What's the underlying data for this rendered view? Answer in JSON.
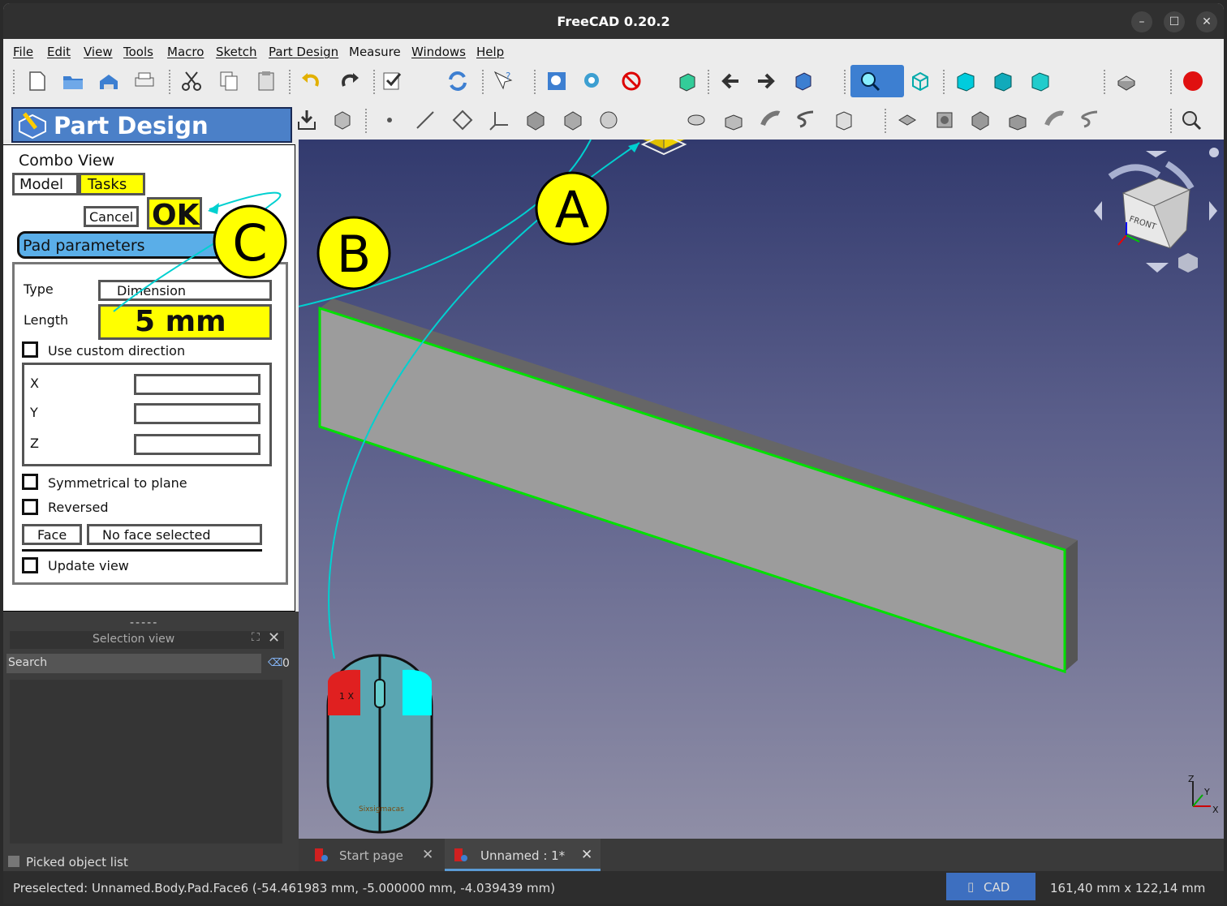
{
  "window": {
    "title": "FreeCAD 0.20.2"
  },
  "menu": [
    "File",
    "Edit",
    "View",
    "Tools",
    "Macro",
    "Sketch",
    "Part Design",
    "Measure",
    "Windows",
    "Help"
  ],
  "workbench": {
    "label": "Part Design"
  },
  "combo": {
    "title": "Combo View",
    "tabs": {
      "model": "Model",
      "tasks": "Tasks"
    },
    "cancel_label": "Cancel",
    "ok_label": "OK",
    "section_title": "Pad parameters",
    "type_label": "Type",
    "type_value": "Dimension",
    "length_label": "Length",
    "length_value": "5 mm",
    "custom_direction_label": "Use custom direction",
    "axis_labels": {
      "x": "X",
      "y": "Y",
      "z": "Z"
    },
    "symmetrical_label": "Symmetrical to plane",
    "reversed_label": "Reversed",
    "face_button": "Face",
    "face_value": "No face selected",
    "update_view_label": "Update view",
    "splitter": "-----"
  },
  "selection_view": {
    "title": "Selection view",
    "search_label": "Search",
    "count": "0",
    "picked_label": "Picked object list"
  },
  "annotations": {
    "a": "A",
    "b": "B",
    "c": "C",
    "mouse_click": "1 X",
    "mouse_brand": "Sixsigmacas"
  },
  "navcube": {
    "face_label": "FRONT"
  },
  "axes": {
    "x": "X",
    "y": "Y",
    "z": "Z"
  },
  "tabs": {
    "start": "Start page",
    "doc": "Unnamed : 1*"
  },
  "status": {
    "preselected": "Preselected: Unnamed.Body.Pad.Face6 (-54.461983 mm, -5.000000 mm, -4.039439 mm)",
    "nav_style": "CAD",
    "dimensions": "161,40 mm x 122,14 mm"
  },
  "colors": {
    "highlight": "#ffff00",
    "edge_highlight": "#00e000",
    "callout_line": "#00d0d0"
  }
}
